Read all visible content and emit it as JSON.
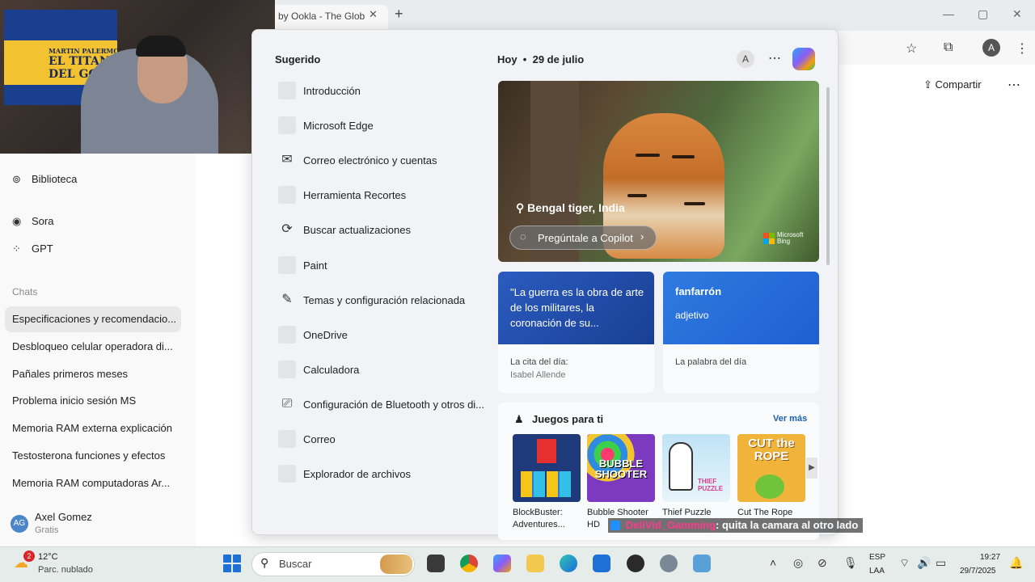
{
  "browser": {
    "tab_title": "by Ookla - The Glob",
    "tab_close": "✕",
    "new_tab": "+",
    "window_controls": [
      "—",
      "▢",
      "✕"
    ],
    "profile_initial": "A",
    "share_label": "Compartir",
    "more": "⋯"
  },
  "webcam": {
    "flag_line1": "MARTIN PALERMO",
    "flag_line2": "EL TITAN",
    "flag_line3": "DEL GOL"
  },
  "sidebar": {
    "top_items": [
      {
        "label": "Biblioteca",
        "icon": "library-icon"
      },
      {
        "label": "Sora",
        "icon": "sora-icon"
      },
      {
        "label": "GPT",
        "icon": "gpt-icon"
      }
    ],
    "chats_label": "Chats",
    "chats": [
      "Especificaciones y recomendacio...",
      "Desbloqueo celular operadora di...",
      "Pañales primeros meses",
      "Problema inicio sesión MS",
      "Memoria RAM externa explicación",
      "Testosterona funciones y efectos",
      "Memoria RAM computadoras Ar..."
    ],
    "user": {
      "initials": "AG",
      "name": "Axel Gomez",
      "plan": "Gratis"
    }
  },
  "start_menu": {
    "suggested_title": "Sugerido",
    "suggested": [
      {
        "label": "Introducción",
        "icon": ""
      },
      {
        "label": "Microsoft Edge",
        "icon": ""
      },
      {
        "label": "Correo electrónico y cuentas",
        "icon": "✉"
      },
      {
        "label": "Herramienta Recortes",
        "icon": ""
      },
      {
        "label": "Buscar actualizaciones",
        "icon": "⟳"
      },
      {
        "label": "Paint",
        "icon": ""
      },
      {
        "label": "Temas y configuración relacionada",
        "icon": "✎"
      },
      {
        "label": "OneDrive",
        "icon": ""
      },
      {
        "label": "Calculadora",
        "icon": ""
      },
      {
        "label": "Configuración de Bluetooth y otros di...",
        "icon": "⎚"
      },
      {
        "label": "Correo",
        "icon": ""
      },
      {
        "label": "Explorador de archivos",
        "icon": ""
      }
    ],
    "date_today": "Hoy",
    "date_sep": "•",
    "date_value": "29 de julio",
    "avatar_initial": "A",
    "more": "⋯",
    "hero": {
      "location": "Bengal tiger, India",
      "ask_copilot": "Pregúntale a Copilot",
      "brand": "Microsoft Bing"
    },
    "quote_card": {
      "quote": "\"La guerra es la obra de arte de los militares, la coronación de su...",
      "label": "La cita del día:",
      "author": "Isabel Allende",
      "color": "#2a5bbf"
    },
    "word_card": {
      "word": "fanfarrón",
      "type": "adjetivo",
      "label": "La palabra del día",
      "color": "#2f7be0"
    },
    "games": {
      "title": "Juegos para ti",
      "see_more": "Ver más",
      "items": [
        {
          "name": "BlockBuster: Adventures...",
          "thumb_text": ""
        },
        {
          "name": "Bubble Shooter HD",
          "thumb_text": "BUBBLE SHOOTER"
        },
        {
          "name": "Thief Puzzle",
          "thumb_text": "THIEF PUZZLE"
        },
        {
          "name": "Cut The Rope",
          "thumb_text": "CUT the ROPE"
        }
      ]
    }
  },
  "stream_overlay": {
    "user": "DeliVid_Gamming",
    "message": ": quita la camara al otro lado"
  },
  "taskbar": {
    "weather_badge": "2",
    "temperature": "12°C",
    "weather_desc": "Parc. nublado",
    "search_placeholder": "Buscar",
    "lang_1": "ESP",
    "lang_2": "LAA",
    "time": "19:27",
    "date": "29/7/2025"
  }
}
